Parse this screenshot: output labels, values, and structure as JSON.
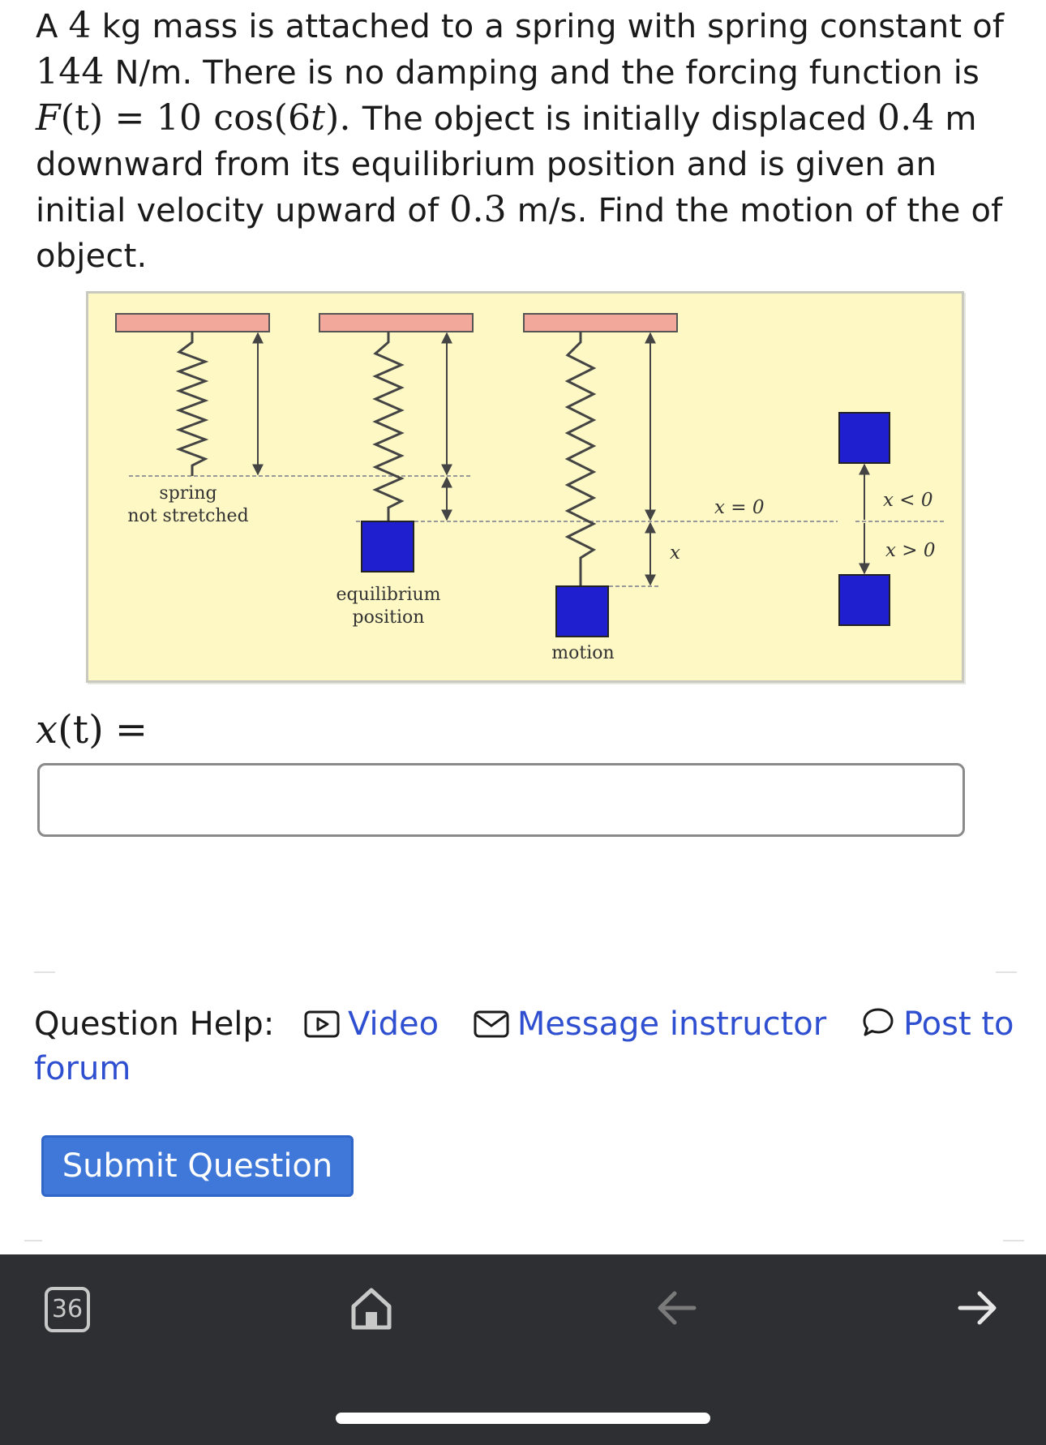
{
  "problem": {
    "part1": "A ",
    "mass_value": "4",
    "part2": " kg mass is attached to a spring with spring constant of ",
    "k_value": "144",
    "part3": " N/m. There is no damping and the forcing function is",
    "F_lhs": "F",
    "F_arg": "(t)",
    "F_eq": " = 10 cos(6",
    "F_t": "t",
    "F_close": "). ",
    "part4": "The object is initially displaced ",
    "disp_value": "0.4",
    "part5": " m downward from its equilibrium position and is given an initial velocity upward of ",
    "vel_value": "0.3",
    "part6": " m/s. Find the motion of the of object."
  },
  "figure": {
    "label_spring": "spring",
    "label_not_stretched": "not stretched",
    "label_equilibrium": "equilibrium",
    "label_position": "position",
    "label_motion": "motion",
    "label_x": "x",
    "label_x_eq_0": "x = 0",
    "label_x_lt_0": "x < 0",
    "label_x_gt_0": "x > 0",
    "colors": {
      "ceiling": "#f2a89a",
      "block": "#1f1fd0",
      "background": "#fdf8c4"
    }
  },
  "answer": {
    "label_x": "x",
    "label_t": "(t)",
    "label_eq": "=",
    "value": "",
    "placeholder": ""
  },
  "help": {
    "label": "Question Help:",
    "video": "Video",
    "message": "Message instructor",
    "forum": "Post to forum",
    "icons": [
      "video-icon",
      "mail-icon",
      "speech-bubble-icon"
    ]
  },
  "submit_label": "Submit Question",
  "browser_bar": {
    "tab_count": "36",
    "icons": [
      "home-icon",
      "back-arrow-icon",
      "forward-arrow-icon"
    ]
  }
}
